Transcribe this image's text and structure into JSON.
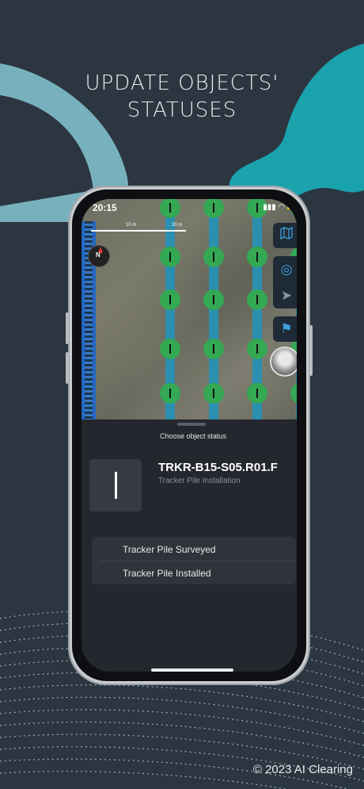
{
  "headline": {
    "line1": "UPDATE OBJECTS'",
    "line2": "STATUSES"
  },
  "copyright": "© 2023 AI Clearing",
  "status_bar": {
    "time": "20:15"
  },
  "map": {
    "scale_labels": [
      "10 m",
      "20 m"
    ],
    "compass_label": "N",
    "buttons": [
      {
        "icon": "map-icon"
      },
      {
        "icon": "locate-icon"
      },
      {
        "icon": "navigate-icon"
      },
      {
        "icon": "flag-icon"
      }
    ],
    "pile_color": "#34a853",
    "row_color": "#2b8fb0"
  },
  "sheet": {
    "title": "Choose object status",
    "object": {
      "code": "TRKR-B15-S05.R01.F",
      "type": "Tracker Pile Installation"
    },
    "options": [
      "Tracker Pile Surveyed",
      "Tracker Pile Installed"
    ]
  },
  "colors": {
    "background": "#2b3640",
    "accent_teal": "#1aa2ad",
    "accent_light": "#7fbfcc"
  }
}
